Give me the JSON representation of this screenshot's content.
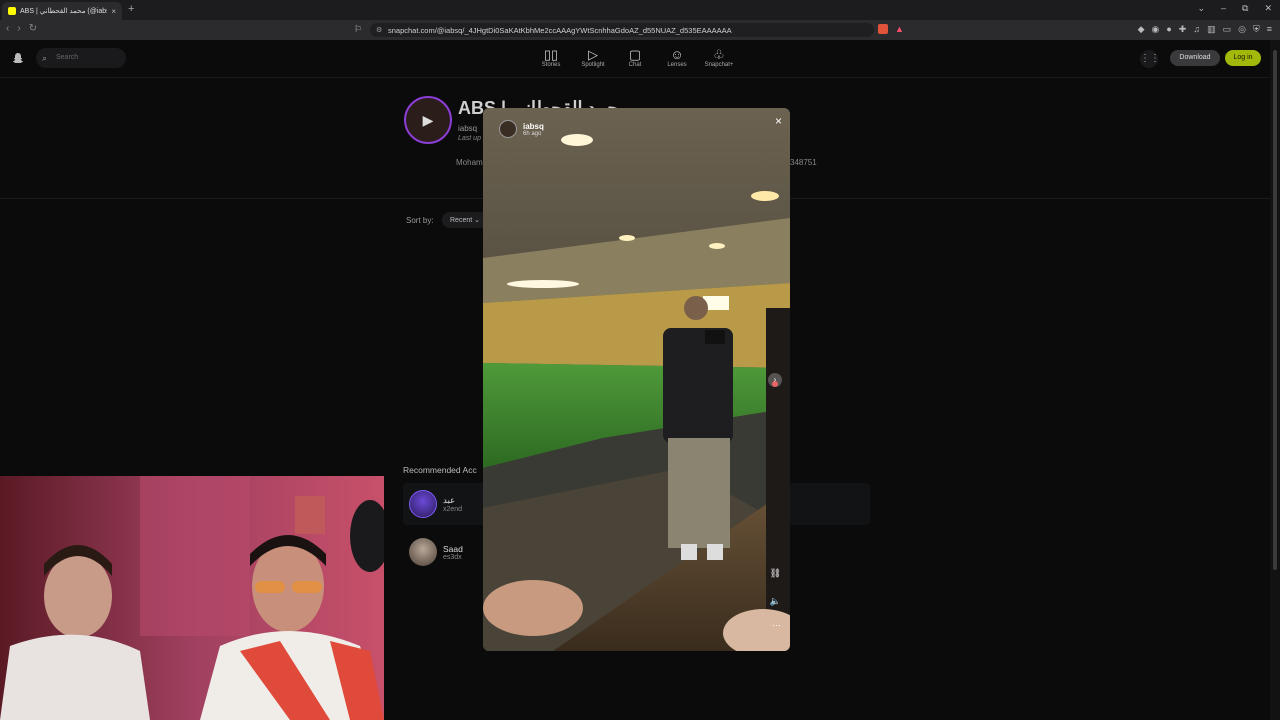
{
  "browser": {
    "tab_title": "ABS | محمد القحطاني (@iabsq)",
    "tab_close": "×",
    "new_tab": "+",
    "url": "snapchat.com/@iabsq/_4JHgtDi0SaKAtKbhMe2ccAAAgYWtScnhhaGdoAZ_d55NUAZ_d535EAAAAAA",
    "window_controls": [
      "⌄",
      "–",
      "⧉",
      "✕"
    ],
    "nav": [
      "‹",
      "›",
      "↻"
    ]
  },
  "header": {
    "search_placeholder": "Search",
    "nav_items": [
      {
        "label": "Stories",
        "icon": "stories-icon",
        "glyph": "▯▯"
      },
      {
        "label": "Spotlight",
        "icon": "spotlight-icon",
        "glyph": "▷"
      },
      {
        "label": "Chat",
        "icon": "chat-icon",
        "glyph": "▢"
      },
      {
        "label": "Lenses",
        "icon": "lenses-icon",
        "glyph": "☺"
      },
      {
        "label": "Snapchat+",
        "icon": "snapchat-plus-icon",
        "glyph": "♧"
      }
    ],
    "download_label": "Download",
    "login_label": "Log in",
    "accent": "#a2b80a"
  },
  "profile": {
    "name": "ABS | محمد القحطاني",
    "handle": "iabsq",
    "updated": "Last up",
    "bio": "Moham",
    "number": "348751",
    "sort_label": "Sort by:",
    "sort_value": "Recent"
  },
  "recommended": {
    "title": "Recommended Acc",
    "items": [
      {
        "name": "عبد",
        "handle": "x2end"
      },
      {
        "name": "Saad",
        "handle": "es3dx"
      }
    ]
  },
  "story": {
    "username": "iabsq",
    "time": "6h ago",
    "close": "×",
    "link": "⛓",
    "sound": "🔈",
    "more": "⋯",
    "next": "›"
  }
}
